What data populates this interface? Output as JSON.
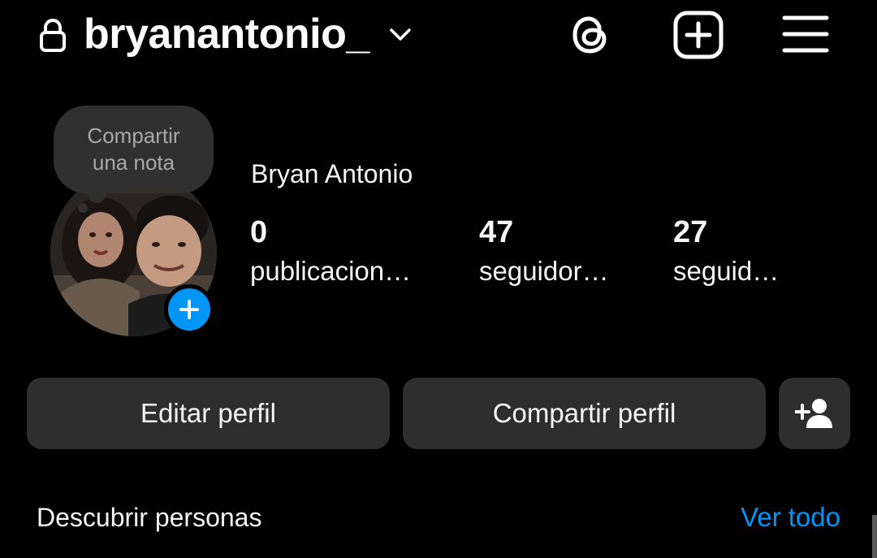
{
  "header": {
    "username": "bryanantonio_",
    "lock_icon": "lock-icon",
    "chevron_icon": "chevron-down-icon",
    "threads_icon": "threads-icon",
    "new_post_icon": "plus-square-icon",
    "menu_icon": "hamburger-menu-icon"
  },
  "note": {
    "line1": "Compartir",
    "line2": "una nota"
  },
  "profile": {
    "display_name": "Bryan Antonio",
    "add_story_icon": "plus-icon"
  },
  "stats": [
    {
      "count": "0",
      "label": "publicacion…"
    },
    {
      "count": "47",
      "label": "seguidor…"
    },
    {
      "count": "27",
      "label": "seguid…"
    }
  ],
  "actions": {
    "edit_label": "Editar perfil",
    "share_label": "Compartir perfil",
    "add_friend_icon": "person-add-icon"
  },
  "discover": {
    "title": "Descubrir personas",
    "see_all": "Ver todo"
  },
  "colors": {
    "background": "#000000",
    "button": "#2e2e2e",
    "note_bubble": "#303030",
    "accent_blue": "#0095f6",
    "text": "#f5f5f5",
    "muted_text": "#a8a8a8"
  }
}
